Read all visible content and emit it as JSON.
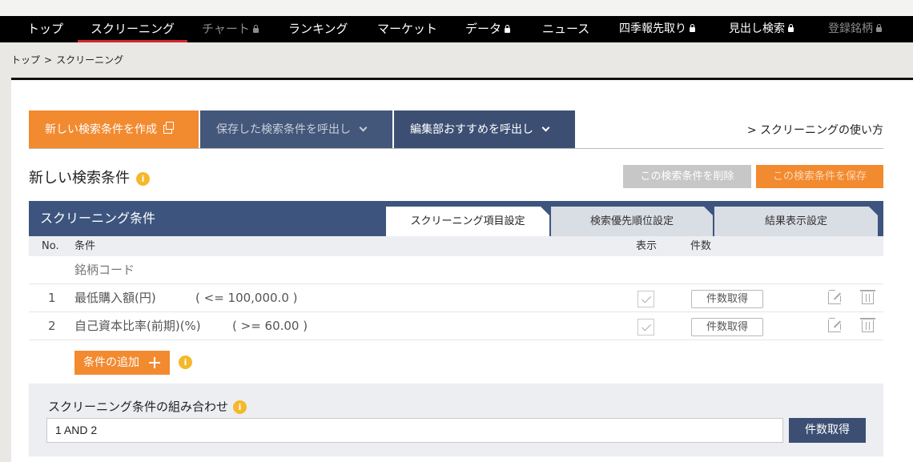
{
  "nav": {
    "items": [
      {
        "label": "トップ",
        "locked": false,
        "disabled": false
      },
      {
        "label": "スクリーニング",
        "locked": false,
        "disabled": false,
        "active": true
      },
      {
        "label": "チャート",
        "locked": true,
        "disabled": true
      },
      {
        "label": "ランキング",
        "locked": false,
        "disabled": false
      },
      {
        "label": "マーケット",
        "locked": false,
        "disabled": false
      },
      {
        "label": "データ",
        "locked": true,
        "disabled": false
      },
      {
        "label": "ニュース",
        "locked": false,
        "disabled": false
      },
      {
        "label": "四季報先取り",
        "locked": true,
        "disabled": false
      },
      {
        "label": "見出し検索",
        "locked": true,
        "disabled": false
      },
      {
        "label": "登録銘柄",
        "locked": true,
        "disabled": true
      }
    ]
  },
  "breadcrumb": {
    "home": "トップ",
    "sep": ">",
    "current": "スクリーニング"
  },
  "toptabs": {
    "new": "新しい検索条件を作成",
    "saved": "保存した検索条件を呼出し",
    "recommended": "編集部おすすめを呼出し",
    "howto": "> スクリーニングの使い方"
  },
  "section": {
    "title": "新しい検索条件",
    "delete_label": "この検索条件を削除",
    "save_label": "この検索条件を保存"
  },
  "conditions": {
    "title": "スクリーニング条件",
    "tabs": [
      "スクリーニング項目設定",
      "検索優先順位設定",
      "結果表示設定"
    ],
    "headers": {
      "no": "No.",
      "cond": "条件",
      "show": "表示",
      "count": "件数"
    },
    "code_row": "銘柄コード",
    "rows": [
      {
        "no": "1",
        "label": "最低購入額(円)",
        "expr": "( <= 100,000.0 )",
        "count_label": "件数取得"
      },
      {
        "no": "2",
        "label": "自己資本比率(前期)(%)",
        "expr": "( >= 60.00 )",
        "count_label": "件数取得"
      }
    ],
    "add_label": "条件の追加"
  },
  "combo": {
    "title": "スクリーニング条件の組み合わせ",
    "value": "1 AND 2",
    "button": "件数取得"
  },
  "colors": {
    "accent_orange": "#f28a30",
    "navy": "#3d557e",
    "nav_active": "#d6262c",
    "info": "#f5b82a"
  }
}
